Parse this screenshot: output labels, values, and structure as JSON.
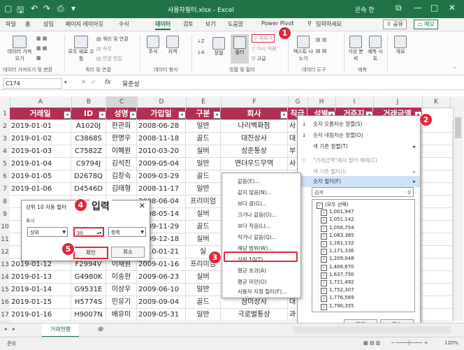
{
  "window": {
    "title": "사용자필터.xlsx - Excel",
    "user": "은숙 한",
    "min": "—",
    "max": "□",
    "close": "✕",
    "restore": "⧉"
  },
  "ribbon_tabs": [
    "파일",
    "홈",
    "삽입",
    "페이지 레이아웃",
    "수식",
    "데이터",
    "검토",
    "보기",
    "도움말",
    "Power Pivot",
    "입력하세요"
  ],
  "share": {
    "share_label": "공유",
    "memo_label": "메모"
  },
  "ribbon": {
    "g1": {
      "btn1": "데이터 가져오기",
      "label": "데이터 가져오기 및 변환"
    },
    "g2": {
      "btn1": "모두 새로 고침",
      "s1": "쿼리 및 연결",
      "s2": "속성",
      "s3": "연결 편집",
      "label": "쿼리 및 연결"
    },
    "g3": {
      "b1": "주식",
      "b2": "지역",
      "label": "데이터 형식"
    },
    "g4": {
      "sort_az": "정렬",
      "filter": "필터",
      "clear": "지우기",
      "reapply": "다시 적용",
      "adv": "고급",
      "label": "정렬 및 필터"
    },
    "g5": {
      "b1": "텍스트 나누기",
      "label": "데이터 도구"
    },
    "g6": {
      "b1": "가상 분석",
      "b2": "예측 시트",
      "label": "예측"
    },
    "g7": {
      "b1": "개요"
    }
  },
  "formula_bar": {
    "name_box": "C174",
    "fx": "fx",
    "value": "유준상"
  },
  "columns": [
    "A",
    "B",
    "C",
    "D",
    "E",
    "F",
    "G",
    "H",
    "I",
    "J",
    "K"
  ],
  "header": [
    "거래일",
    "ID",
    "성명",
    "가입일",
    "구분",
    "회사",
    "직급",
    "성별",
    "거주지",
    "거래금액"
  ],
  "rows": [
    [
      "2019-01-01",
      "A1020J",
      "한관희",
      "2008-06-28",
      "일반",
      "나리백화점",
      "사"
    ],
    [
      "2019-01-02",
      "C3868S",
      "한명우",
      "2008-11-18",
      "골드",
      "대진상사",
      "대"
    ],
    [
      "2019-01-03",
      "C7582Z",
      "이혜원",
      "2010-03-20",
      "실버",
      "성준통상",
      "부"
    ],
    [
      "2019-01-04",
      "C9794J",
      "김석진",
      "2009-05-04",
      "일반",
      "연더우드무역",
      "사"
    ],
    [
      "2019-01-05",
      "D2678Q",
      "김창숙",
      "2009-03-29",
      "골드",
      "",
      "사"
    ],
    [
      "2019-01-06",
      "D4546D",
      "김태형",
      "2008-11-17",
      "일반",
      "",
      ""
    ],
    [
      "",
      "",
      "",
      "2008-06-04",
      "프리미엄",
      "",
      ""
    ],
    [
      "",
      "",
      "",
      "2008-05-14",
      "실버",
      "",
      ""
    ],
    [
      "",
      "",
      "",
      "2009-11-29",
      "골드",
      "",
      ""
    ],
    [
      "",
      "",
      "",
      "2009-12-18",
      "실버",
      "",
      ""
    ],
    [
      "",
      "",
      "",
      "2010-01-21",
      "실",
      "",
      ""
    ],
    [
      "2019-01-12",
      "F2994V",
      "이재원",
      "2009-01-16",
      "프리미엄",
      "",
      ""
    ],
    [
      "2019-01-13",
      "G4980K",
      "이송현",
      "2009-06-23",
      "실버",
      "",
      ""
    ],
    [
      "2019-01-14",
      "G9531E",
      "이상우",
      "2009-06-10",
      "일반",
      "",
      ""
    ],
    [
      "2019-01-15",
      "H5774S",
      "민유기",
      "2009-09-04",
      "골드",
      "삼미상사",
      "대"
    ],
    [
      "2019-01-16",
      "H9007N",
      "배유미",
      "2009-05-31",
      "일반",
      "극로벌통상",
      "과"
    ]
  ],
  "row_numbers": [
    "1",
    "2",
    "3",
    "4",
    "5",
    "6",
    "7",
    "8",
    "9",
    "10",
    "11",
    "12",
    "13",
    "14",
    "15",
    "16",
    "17"
  ],
  "filter_menu": {
    "items": [
      "숫자 오름차순 정렬(S)",
      "숫자 내림차순 정렬(O)",
      "색 기준 정렬(T)",
      "\"거래금액\"에서 필터 해제(C)",
      "색 기준 필터(I)",
      "숫자 필터(F)"
    ],
    "search_placeholder": "검색",
    "checks": [
      "(모두 선택)",
      "1,001,947",
      "1,051,142",
      "1,058,754",
      "1,083,385",
      "1,161,132",
      "1,171,336",
      "1,209,048",
      "1,408,670",
      "1,637,750",
      "1,721,492",
      "1,752,307",
      "1,776,569",
      "1,790,355"
    ],
    "ok": "확인",
    "cancel": "취소"
  },
  "number_submenu": [
    "같음(E)...",
    "같지 않음(N)...",
    "보다 큼(G)...",
    "크거나 같음(O)...",
    "보다 작음(L)...",
    "작거나 같음(Q)...",
    "해당 범위(W)...",
    "상위 10(T)...",
    "평균 초과(A)",
    "평균 미만(O)",
    "사용자 지정 필터(F)..."
  ],
  "dialog": {
    "title": "상위 10 자동 필터",
    "close": "✕",
    "show_label": "표시",
    "dir": "상위",
    "value": "30",
    "unit": "항목",
    "ok": "확인",
    "cancel": "취소"
  },
  "callouts": {
    "c1": "1",
    "c2": "2",
    "c3": "3",
    "c4": "4",
    "c4_label": "입력",
    "c5": "5"
  },
  "sheet": {
    "tab": "거래현황",
    "add": "⊕"
  },
  "status": {
    "left": "준비",
    "right": "120%"
  }
}
